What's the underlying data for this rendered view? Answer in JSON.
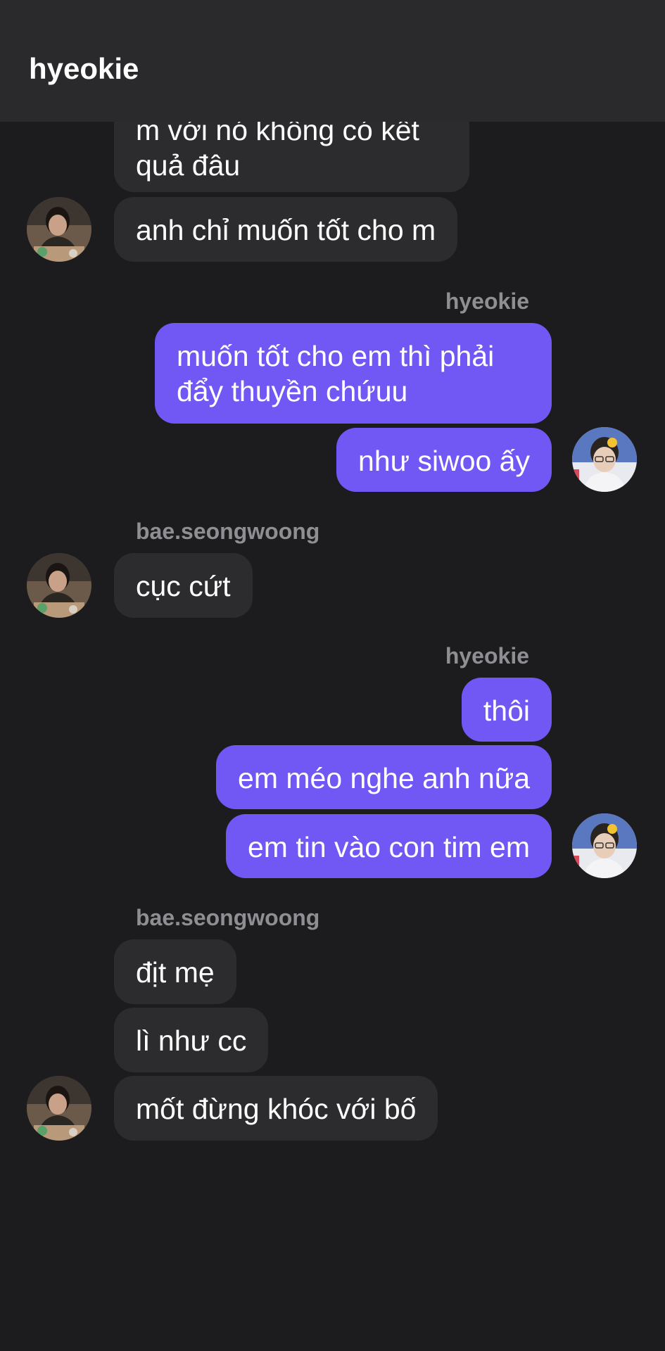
{
  "header": {
    "title": "hyeokie"
  },
  "messages": {
    "m1_text": "m với nó không có kết\nquả đâu",
    "m2_text": "anh chỉ muốn tốt cho m",
    "s1_name": "hyeokie",
    "m3_text": "muốn tốt cho em thì phải\nđẩy thuyền chứuu",
    "m4_text": "như siwoo ấy",
    "s2_name": "bae.seongwoong",
    "m5_text": "cục cứt",
    "s3_name": "hyeokie",
    "m6_text": "thôi",
    "m7_text": "em méo nghe anh nữa",
    "m8_text": "em tin vào con tim em",
    "s4_name": "bae.seongwoong",
    "m9_text": "địt mẹ",
    "m10_text": "lì như cc",
    "m11_text": "mốt đừng khóc với bố"
  },
  "icons": {
    "contact_avatar": "avatar-bae-seongwoong",
    "self_avatar": "avatar-hyeokie"
  },
  "colors": {
    "background": "#1c1c1e",
    "header_bg": "#2a2a2c",
    "incoming_bubble": "#2c2c2e",
    "outgoing_bubble": "#7158f5",
    "sender_label": "#8e8e93"
  }
}
